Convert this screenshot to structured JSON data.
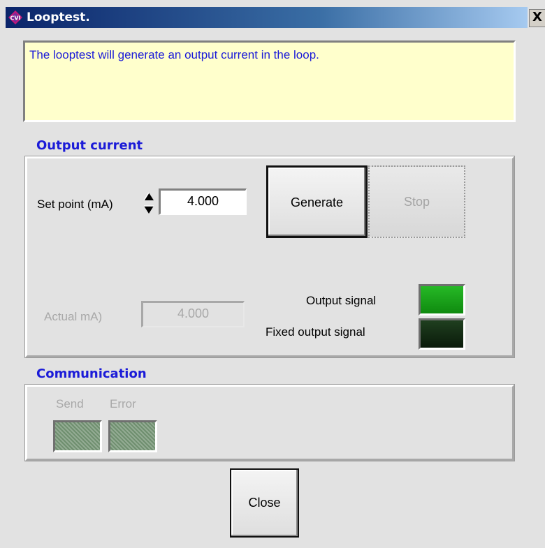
{
  "window": {
    "title": "Looptest.",
    "close_glyph": "X",
    "app_icon": "cvi-diamond-icon"
  },
  "message": "The looptest will generate an output current in the loop.",
  "output_current": {
    "section_label": "Output current",
    "setpoint_label": "Set point (mA)",
    "setpoint_value": "4.000",
    "generate_label": "Generate",
    "stop_label": "Stop",
    "actual_label": "Actual mA)",
    "actual_value": "4.000",
    "output_signal_label": "Output signal",
    "fixed_output_signal_label": "Fixed output signal",
    "colors": {
      "output_signal_led": "#16a316",
      "fixed_output_signal_led": "#0f2a0f"
    }
  },
  "communication": {
    "section_label": "Communication",
    "send_label": "Send",
    "error_label": "Error"
  },
  "buttons": {
    "close_label": "Close"
  }
}
